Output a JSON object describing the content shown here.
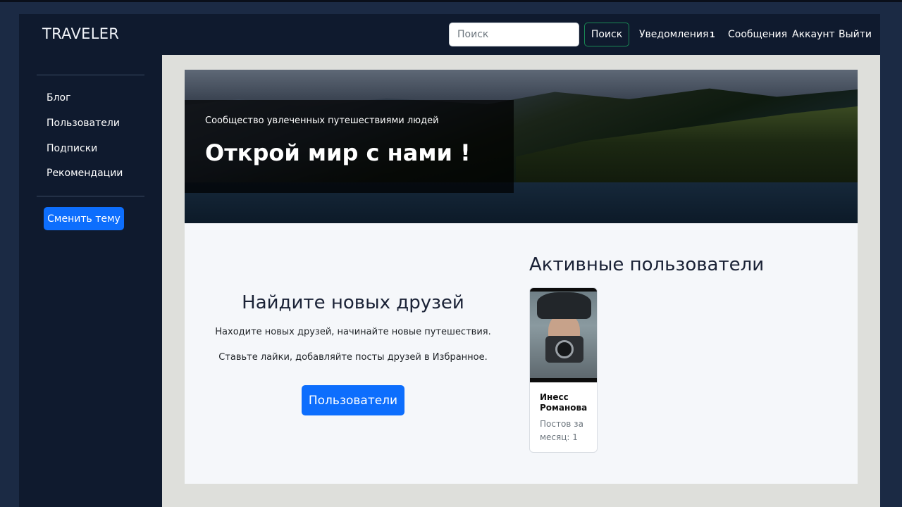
{
  "navbar": {
    "brand": "TRAVELER",
    "search_placeholder": "Поиск",
    "search_button": "Поиск",
    "links": {
      "notifications": "Уведомления",
      "notifications_count": "1",
      "messages": "Сообщения",
      "account": "Аккаунт",
      "logout": "Выйти"
    }
  },
  "sidebar": {
    "items": [
      {
        "label": "Блог"
      },
      {
        "label": "Пользователи"
      },
      {
        "label": "Подписки"
      },
      {
        "label": "Рекомендации"
      }
    ],
    "theme_button": "Сменить тему"
  },
  "hero": {
    "subtitle": "Сообщество увлеченных путешествиями людей",
    "title": "Открой мир с нами !"
  },
  "friends": {
    "title": "Найдите новых друзей",
    "text1": "Находите новых друзей, начинайте новые путешествия.",
    "text2": "Ставьте лайки, добавляйте посты друзей в Избранное.",
    "button": "Пользователи"
  },
  "active_users": {
    "title": "Активные пользователи",
    "users": [
      {
        "name": "Инесс Романова",
        "posts": "Постов за месяц: 1"
      }
    ]
  },
  "colors": {
    "primary": "#0d6efd",
    "success": "#198754",
    "navbar_bg": "#0f1a2e",
    "page_bg": "#1b2a44"
  }
}
